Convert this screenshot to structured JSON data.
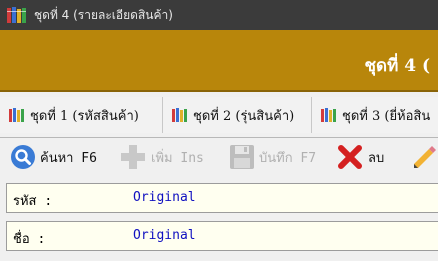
{
  "window": {
    "title": "ชุดที่ 4 (รายละเอียดสินค้า)"
  },
  "header": {
    "title": "ชุดที่ 4 ("
  },
  "tabs": [
    {
      "label": "ชุดที่ 1 (รหัสสินค้า)"
    },
    {
      "label": "ชุดที่ 2 (รุ่นสินค้า)"
    },
    {
      "label": "ชุดที่ 3 (ยี่ห้อสิน"
    }
  ],
  "toolbar": {
    "search_label": "ค้นหา F6",
    "add_label": "เพิ่ม Ins",
    "save_label": "บันทึก F7",
    "delete_label": "ลบ"
  },
  "form": {
    "code_label": "รหัส :",
    "code_value": "Original",
    "name_label": "ชื่อ :",
    "name_value": "Original"
  },
  "colors": {
    "header_bg": "#b8860b",
    "titlebar_bg": "#3b3b3b",
    "field_bg": "#fffff0",
    "value_text": "#1010c0"
  },
  "icons": {
    "app": "books-icon",
    "search": "magnifier-icon",
    "add": "plus-icon",
    "save": "floppy-disk-icon",
    "delete": "red-x-icon",
    "edit": "pencil-icon"
  }
}
